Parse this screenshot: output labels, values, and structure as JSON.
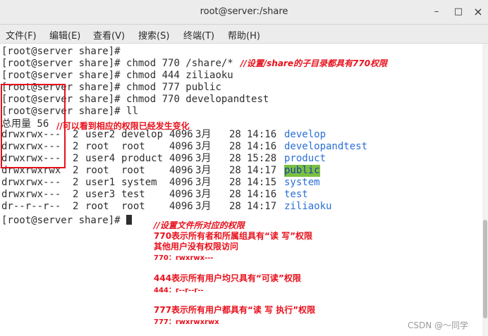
{
  "window": {
    "title": "root@server:/share",
    "minimize": "–",
    "maximize": "□",
    "close": "×"
  },
  "menu": [
    "文件(F)",
    "编辑(E)",
    "查看(V)",
    "搜索(S)",
    "终端(T)",
    "帮助(H)"
  ],
  "terminal": {
    "prompts": [
      {
        "prompt": "[root@server share]# ",
        "cmd": ""
      },
      {
        "prompt": "[root@server share]# ",
        "cmd": "chmod 770 /share/*"
      },
      {
        "prompt": "[root@server share]# ",
        "cmd": "chmod 444 ziliaoku"
      },
      {
        "prompt": "[root@server share]# ",
        "cmd": "chmod 777 public"
      },
      {
        "prompt": "[root@server share]# ",
        "cmd": "chmod 770 developandtest"
      },
      {
        "prompt": "[root@server share]# ",
        "cmd": "ll"
      }
    ],
    "total": "总用量 56",
    "listing": [
      {
        "perm": "drwxrwx---",
        "links": "2",
        "owner": "user2",
        "group": "develop",
        "size": "4096",
        "month": "3月",
        "day": "28",
        "time": "14:16",
        "name": "develop"
      },
      {
        "perm": "drwxrwx---",
        "links": "2",
        "owner": "root",
        "group": "root",
        "size": "4096",
        "month": "3月",
        "day": "28",
        "time": "14:16",
        "name": "developandtest"
      },
      {
        "perm": "drwxrwx---",
        "links": "2",
        "owner": "user4",
        "group": "product",
        "size": "4096",
        "month": "3月",
        "day": "28",
        "time": "15:28",
        "name": "product"
      },
      {
        "perm": "drwxrwxrwx",
        "links": "2",
        "owner": "root",
        "group": "root",
        "size": "4096",
        "month": "3月",
        "day": "28",
        "time": "14:17",
        "name": "public"
      },
      {
        "perm": "drwxrwx---",
        "links": "2",
        "owner": "user1",
        "group": "system",
        "size": "4096",
        "month": "3月",
        "day": "28",
        "time": "14:15",
        "name": "system"
      },
      {
        "perm": "drwxrwx---",
        "links": "2",
        "owner": "user3",
        "group": "test",
        "size": "4096",
        "month": "3月",
        "day": "28",
        "time": "14:16",
        "name": "test"
      },
      {
        "perm": "dr--r--r--",
        "links": "2",
        "owner": "root",
        "group": "root",
        "size": "4096",
        "month": "3月",
        "day": "28",
        "time": "14:17",
        "name": "ziliaoku"
      }
    ],
    "final_prompt": "[root@server share]# "
  },
  "annotations": {
    "cmd_note": "//设置/share的子目录都具有770权限",
    "list_note": "//可以看到相应的权限已经发生变化",
    "explain": [
      "//设置文件所对应的权限",
      "770表示所有者和所属组具有“读 写”权限",
      "其他用户没有权限访问",
      "770：rwxrwx---",
      "444表示所有用户均只具有“可读”权限",
      "444：r--r--r--",
      "777表示所有用户都具有“读 写 执行”权限",
      "777：rwxrwxrwx"
    ],
    "color": "#e8111c"
  },
  "watermark": "CSDN @～同学"
}
